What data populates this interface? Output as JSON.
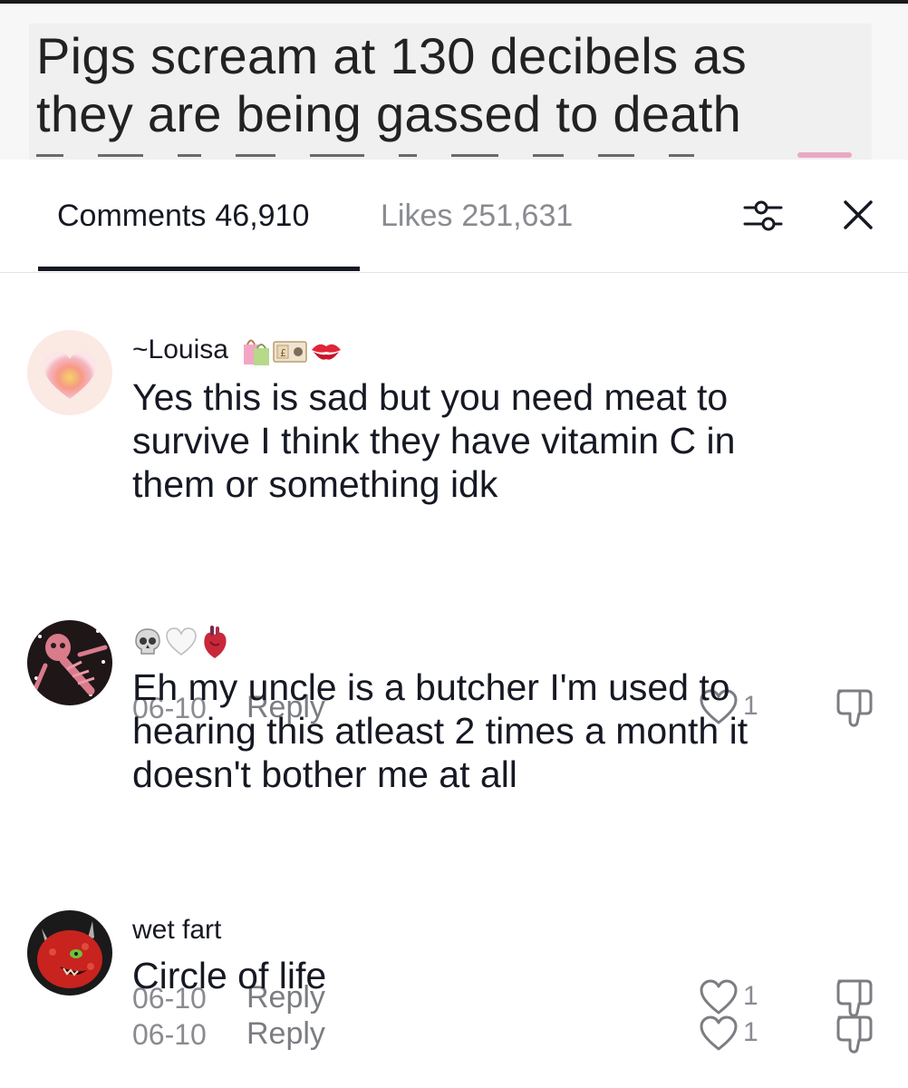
{
  "video": {
    "caption_lines": [
      "Pigs scream at 130 decibels as",
      "they are being gassed to death"
    ]
  },
  "tabs": {
    "comments_label": "Comments",
    "comments_count": "46,910",
    "likes_label": "Likes",
    "likes_count": "251,631",
    "filter_icon": "sliders-icon",
    "close_icon": "close-icon"
  },
  "comments": [
    {
      "username": "~Louisa",
      "username_emojis": [
        "shopping-bags-emoji",
        "pound-banknote-emoji",
        "kiss-mark-emoji"
      ],
      "avatar": "pink-heart-avatar",
      "lines": [
        "Yes this is sad but you need meat to",
        "survive I think they have vitamin C in",
        "them or something idk"
      ],
      "date": "06-10",
      "reply_label": "Reply",
      "likes": "1"
    },
    {
      "username": "",
      "username_emojis": [
        "skull-emoji",
        "white-heart-emoji",
        "anatomical-heart-emoji"
      ],
      "avatar": "pink-skeleton-avatar",
      "lines": [
        "Eh my uncle is a butcher I'm used to",
        "hearing this atleast 2 times a month it",
        "doesn't bother me at all"
      ],
      "date": "06-10",
      "reply_label": "Reply",
      "likes": "1"
    },
    {
      "username": "wet fart",
      "username_emojis": [],
      "avatar": "red-demon-avatar",
      "lines": [
        "Circle of life"
      ],
      "date": "06-10",
      "reply_label": "Reply",
      "likes": "1"
    }
  ],
  "colors": {
    "text_primary": "#161823",
    "text_secondary": "#8a8b91",
    "divider": "#e3e3e4"
  }
}
